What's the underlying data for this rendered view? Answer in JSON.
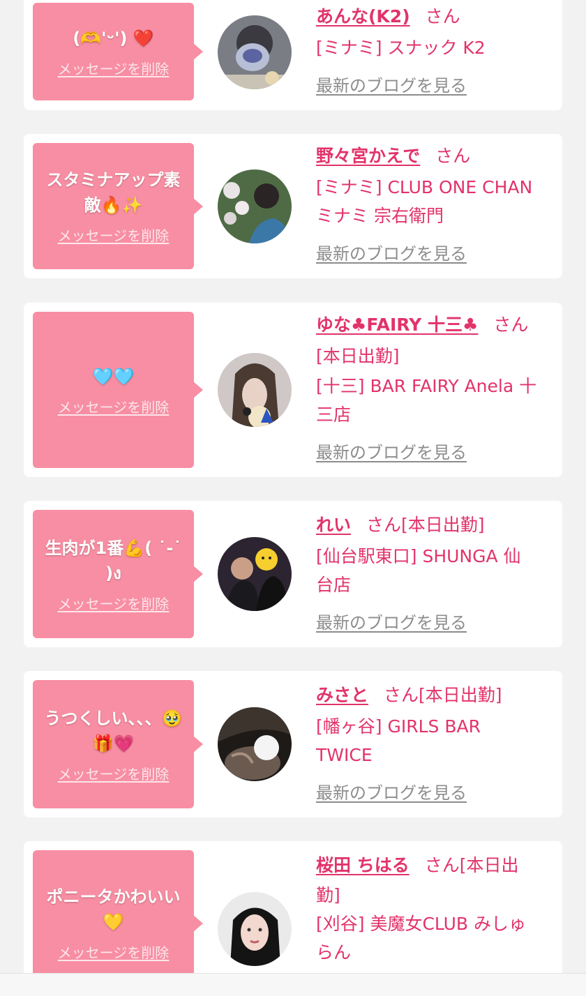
{
  "accent_color": "#e2336a",
  "bubble_color": "#f88ea3",
  "link_gray": "#8c8c8c",
  "delete_label": "メッセージを削除",
  "blog_label": "最新のブログを見る",
  "san": "さん",
  "cards": [
    {
      "message": "(🫶'ᵕ')  ❤️",
      "name": "あんな(K2)",
      "lines": [
        "[ミナミ] スナック K2"
      ],
      "avatar": "avatar-girl-mask-sticker"
    },
    {
      "message": "スタミナアップ素敵🔥✨",
      "name": "野々宮かえで",
      "lines": [
        "[ミナミ] CLUB ONE CHAN",
        "ミナミ 宗右衛門"
      ],
      "avatar": "avatar-woman-flowers"
    },
    {
      "message": "🩵🩵",
      "name": "ゆな♣FAIRY 十三♣",
      "lines": [
        "[本日出勤]",
        "[十三] BAR FAIRY Anela 十",
        "三店"
      ],
      "avatar": "avatar-girl-plush"
    },
    {
      "message": "生肉が1番💪( ˙-˙ )ง",
      "name": "れい",
      "suffix": "[本日出勤]",
      "lines": [
        "[仙台駅東口] SHUNGA 仙",
        "台店"
      ],
      "avatar": "avatar-two-girls"
    },
    {
      "message": "うつくしい、、、🥹🎁💗",
      "name": "みさと",
      "suffix": "[本日出勤]",
      "lines": [
        "[幡ヶ谷] GIRLS BAR",
        "TWICE"
      ],
      "avatar": "avatar-dark-photo"
    },
    {
      "message": "ポニータかわいい💛",
      "name": "桜田 ちはる",
      "suffix": "[本日出",
      "lines": [
        "勤]",
        "[刈谷] 美魔女CLUB みしゅ",
        "らん"
      ],
      "avatar": "avatar-woman-portrait"
    }
  ]
}
